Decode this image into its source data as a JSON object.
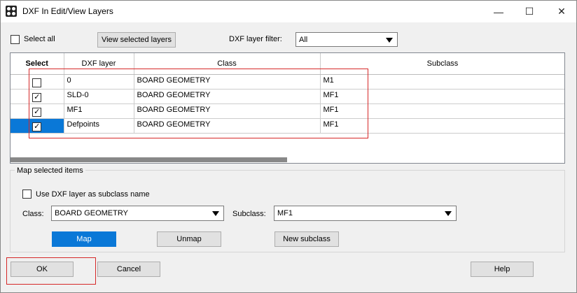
{
  "window": {
    "title": "DXF In Edit/View Layers",
    "controls": {
      "minimize": "—",
      "maximize": "☐",
      "close": "✕"
    }
  },
  "toolbar": {
    "select_all_label": "Select all",
    "select_all_checked": false,
    "view_selected_label": "View selected layers",
    "filter_label": "DXF layer filter:",
    "filter_value": "All"
  },
  "grid": {
    "headers": {
      "select": "Select",
      "layer": "DXF layer",
      "class": "Class",
      "subclass": "Subclass"
    },
    "rows": [
      {
        "checked": "",
        "layer": "0",
        "class": "BOARD GEOMETRY",
        "subclass": "M1"
      },
      {
        "checked": "✓",
        "layer": "SLD-0",
        "class": "BOARD GEOMETRY",
        "subclass": "MF1"
      },
      {
        "checked": "✓",
        "layer": "MF1",
        "class": "BOARD GEOMETRY",
        "subclass": "MF1"
      },
      {
        "checked": "✓",
        "layer": "Defpoints",
        "class": "BOARD GEOMETRY",
        "subclass": "MF1"
      }
    ]
  },
  "map_group": {
    "title": "Map selected items",
    "use_layer_label": "Use DXF layer as subclass name",
    "use_layer_checked": false,
    "class_label": "Class:",
    "class_value": "BOARD GEOMETRY",
    "subclass_label": "Subclass:",
    "subclass_value": "MF1",
    "map_button": "Map",
    "unmap_button": "Unmap",
    "new_subclass_button": "New subclass"
  },
  "footer": {
    "ok_button": "OK",
    "cancel_button": "Cancel",
    "help_button": "Help"
  },
  "colors": {
    "selection": "#0a78d7",
    "highlight": "#d62828"
  }
}
